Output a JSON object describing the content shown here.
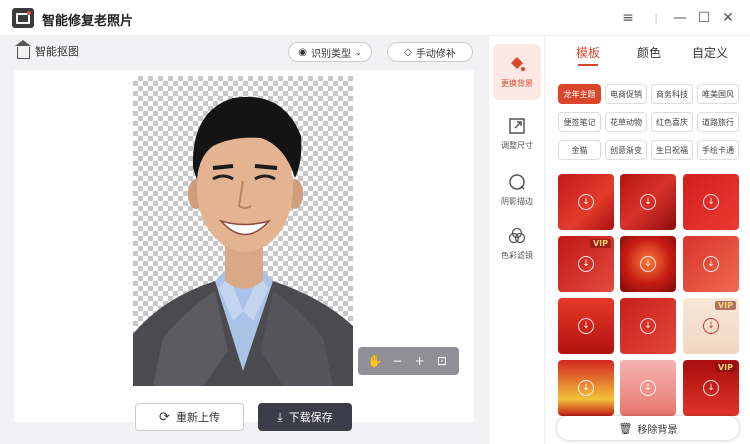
{
  "app": {
    "title": "智能修复老照片"
  },
  "window_controls": {
    "menu": "≡",
    "minimize": "—",
    "maximize": "☐",
    "close": "✕"
  },
  "toolbar": {
    "smart_cutout": "智能抠图",
    "recognize_type": "识别类型",
    "manual_fix": "手动修补"
  },
  "zoom_tools": {
    "hand": "✋",
    "zoom_out": "−",
    "zoom_in": "+",
    "fit": "⊡"
  },
  "actions": {
    "reupload": "重新上传",
    "download_save": "下载保存"
  },
  "tools": [
    {
      "label": "更换背景",
      "icon": "paint-bucket-icon",
      "active": true
    },
    {
      "label": "调整尺寸",
      "icon": "resize-icon",
      "active": false
    },
    {
      "label": "阴影描边",
      "icon": "shadow-stroke-icon",
      "active": false
    },
    {
      "label": "色彩滤镜",
      "icon": "color-filter-icon",
      "active": false
    }
  ],
  "tabs": [
    "模板",
    "颜色",
    "自定义"
  ],
  "active_tab": 0,
  "tags": [
    [
      "龙年主题",
      "电商促销",
      "商务科技",
      "唯美国风"
    ],
    [
      "便签笔记",
      "花草动物",
      "红色喜庆",
      "道路旅行"
    ],
    [
      "金猫",
      "创意渐变",
      "生日祝福",
      "手绘卡通"
    ]
  ],
  "thumbnails": [
    {
      "vip": ""
    },
    {
      "vip": ""
    },
    {
      "vip": ""
    },
    {
      "vip": "VIP"
    },
    {
      "vip": ""
    },
    {
      "vip": ""
    },
    {
      "vip": ""
    },
    {
      "vip": ""
    },
    {
      "vip": "VIP"
    },
    {
      "vip": ""
    },
    {
      "vip": ""
    },
    {
      "vip": "VIP"
    }
  ],
  "remove_background": "移除背景",
  "colors": {
    "accent": "#d9462b",
    "dark_button": "#3d3d4a",
    "zoom_bar": "#8f8f95"
  }
}
